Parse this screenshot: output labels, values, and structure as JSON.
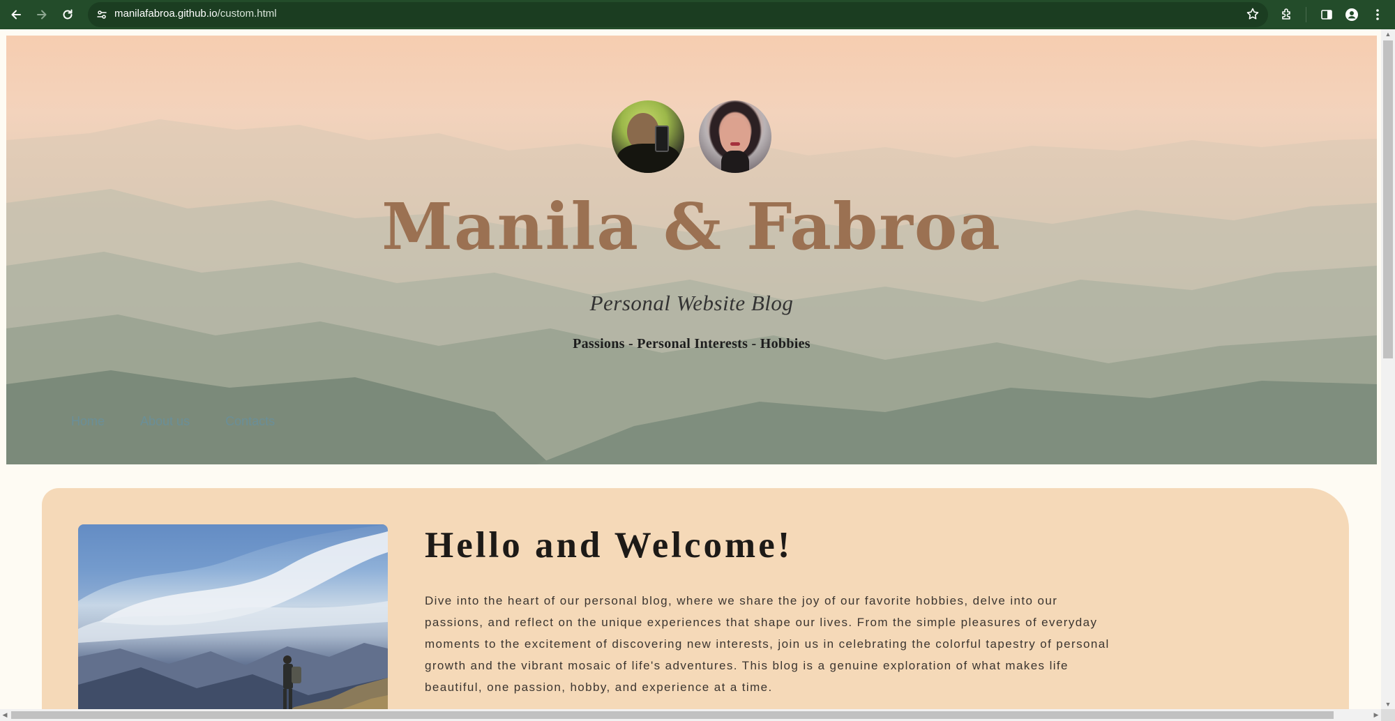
{
  "browser": {
    "url_host": "manilafabroa.github.io",
    "url_path": "/custom.html",
    "icons": [
      "back-arrow-icon",
      "forward-arrow-icon",
      "reload-icon",
      "site-info-icon",
      "bookmark-star-icon",
      "extensions-icon",
      "side-panel-icon",
      "profile-icon",
      "kebab-menu-icon"
    ],
    "colors": {
      "toolbar": "#234c2a",
      "omnibox": "#1b3d21"
    }
  },
  "hero": {
    "title": "Manila & Fabroa",
    "subtitle": "Personal Website Blog",
    "tagline": "Passions - Personal Interests - Hobbies",
    "nav": [
      {
        "label": "Home"
      },
      {
        "label": "About us"
      },
      {
        "label": "Contacts"
      }
    ],
    "colors": {
      "title": "#9b7152",
      "nav": "#6a8f98"
    }
  },
  "welcome": {
    "heading": "Hello and Welcome!",
    "body": "Dive into the heart of our personal blog, where we share the joy of our favorite hobbies, delve into our passions, and reflect on the unique experiences that shape our lives. From the simple pleasures of everyday moments to the excitement of discovering new interests, join us in celebrating the colorful tapestry of personal growth and the vibrant mosaic of life's adventures. This blog is a genuine exploration of what makes life beautiful, one passion, hobby, and experience at a time.",
    "colors": {
      "card": "#f5d9b8",
      "page": "#fefbf3"
    }
  }
}
